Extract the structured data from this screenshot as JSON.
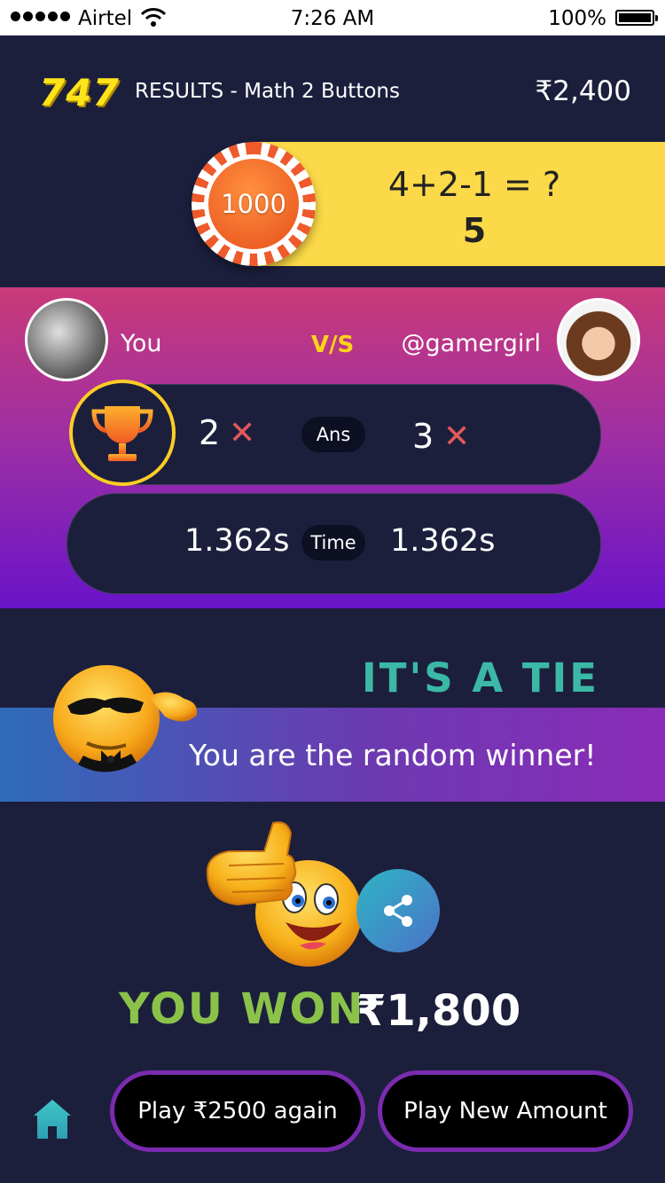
{
  "status_bar": {
    "carrier": "Airtel",
    "time": "7:26 AM",
    "battery": "100%"
  },
  "header": {
    "logo": "747",
    "title": "RESULTS - Math 2 Buttons",
    "balance": "₹2,400"
  },
  "question": {
    "chip_value": "1000",
    "text": "4+2-1 = ?",
    "answer": "5"
  },
  "versus": {
    "you_label": "You",
    "vs_label": "V/S",
    "opponent_label": "@gamergirl",
    "answers": {
      "you": "2",
      "label": "Ans",
      "opponent": "3",
      "mark": "✕"
    },
    "time": {
      "you": "1.362s",
      "label": "Time",
      "opponent": "1.362s"
    }
  },
  "result": {
    "tie_title": "IT'S A TIE",
    "winner_message": "You are the random winner!",
    "won_label": "YOU WON",
    "won_amount": "₹1,800"
  },
  "actions": {
    "play_again": "Play ₹2500 again",
    "play_new": "Play New Amount"
  },
  "colors": {
    "background": "#1c1f3c",
    "banner": "#fbd948",
    "accent_yellow": "#ffd31a",
    "tie_teal": "#3cb8a7",
    "won_green": "#8bc34a",
    "wrong_red": "#e25a5a",
    "button_border": "#7a2bb0"
  },
  "icons": [
    "wifi-icon",
    "battery-icon",
    "trophy-icon",
    "share-icon",
    "home-icon"
  ]
}
